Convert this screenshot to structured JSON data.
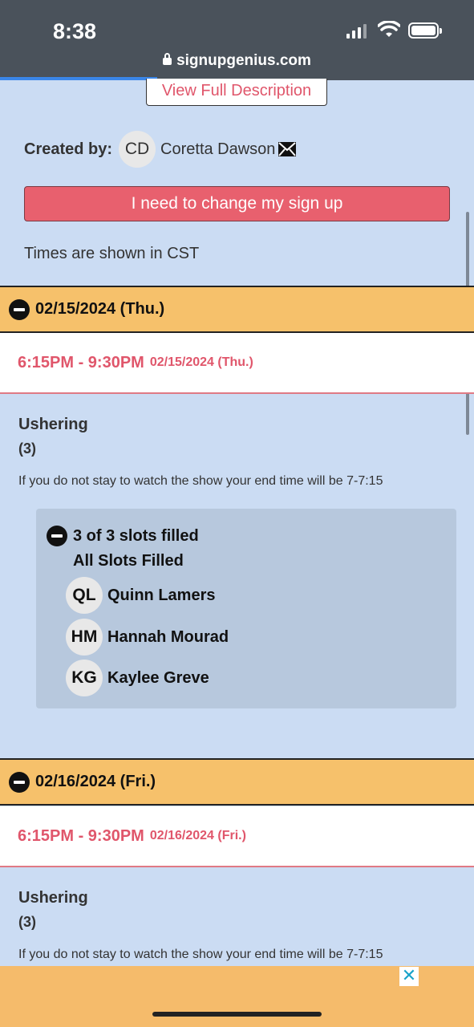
{
  "status": {
    "time": "8:38",
    "url": "signupgenius.com"
  },
  "header": {
    "view_description": "View Full Description",
    "created_by_label": "Created by:",
    "creator_initials": "CD",
    "creator_name": "Coretta Dawson",
    "change_button": "I need to change my sign up",
    "timezone_note": "Times are shown in CST"
  },
  "days": [
    {
      "date": "02/15/2024 (Thu.)",
      "time_range": "6:15PM - 9:30PM",
      "time_date": "02/15/2024 (Thu.)",
      "role": "Ushering",
      "count": "(3)",
      "note": "If you do not stay to watch the show your end time will be 7-7:15",
      "slots_filled": "3 of 3 slots filled",
      "slots_status": "All Slots Filled",
      "people": [
        {
          "initials": "QL",
          "name": "Quinn Lamers"
        },
        {
          "initials": "HM",
          "name": "Hannah Mourad"
        },
        {
          "initials": "KG",
          "name": "Kaylee Greve"
        }
      ]
    },
    {
      "date": "02/16/2024 (Fri.)",
      "time_range": "6:15PM - 9:30PM",
      "time_date": "02/16/2024 (Fri.)",
      "role": "Ushering",
      "count": "(3)",
      "note": "If you do not stay to watch the show your end time will be 7-7:15"
    }
  ],
  "ad": {
    "close_label": "✕"
  },
  "colors": {
    "accent": "#e0566b",
    "date_bar": "#f6c16b",
    "page_bg": "#cbdcf3",
    "slots_bg": "#b7c8dd"
  }
}
